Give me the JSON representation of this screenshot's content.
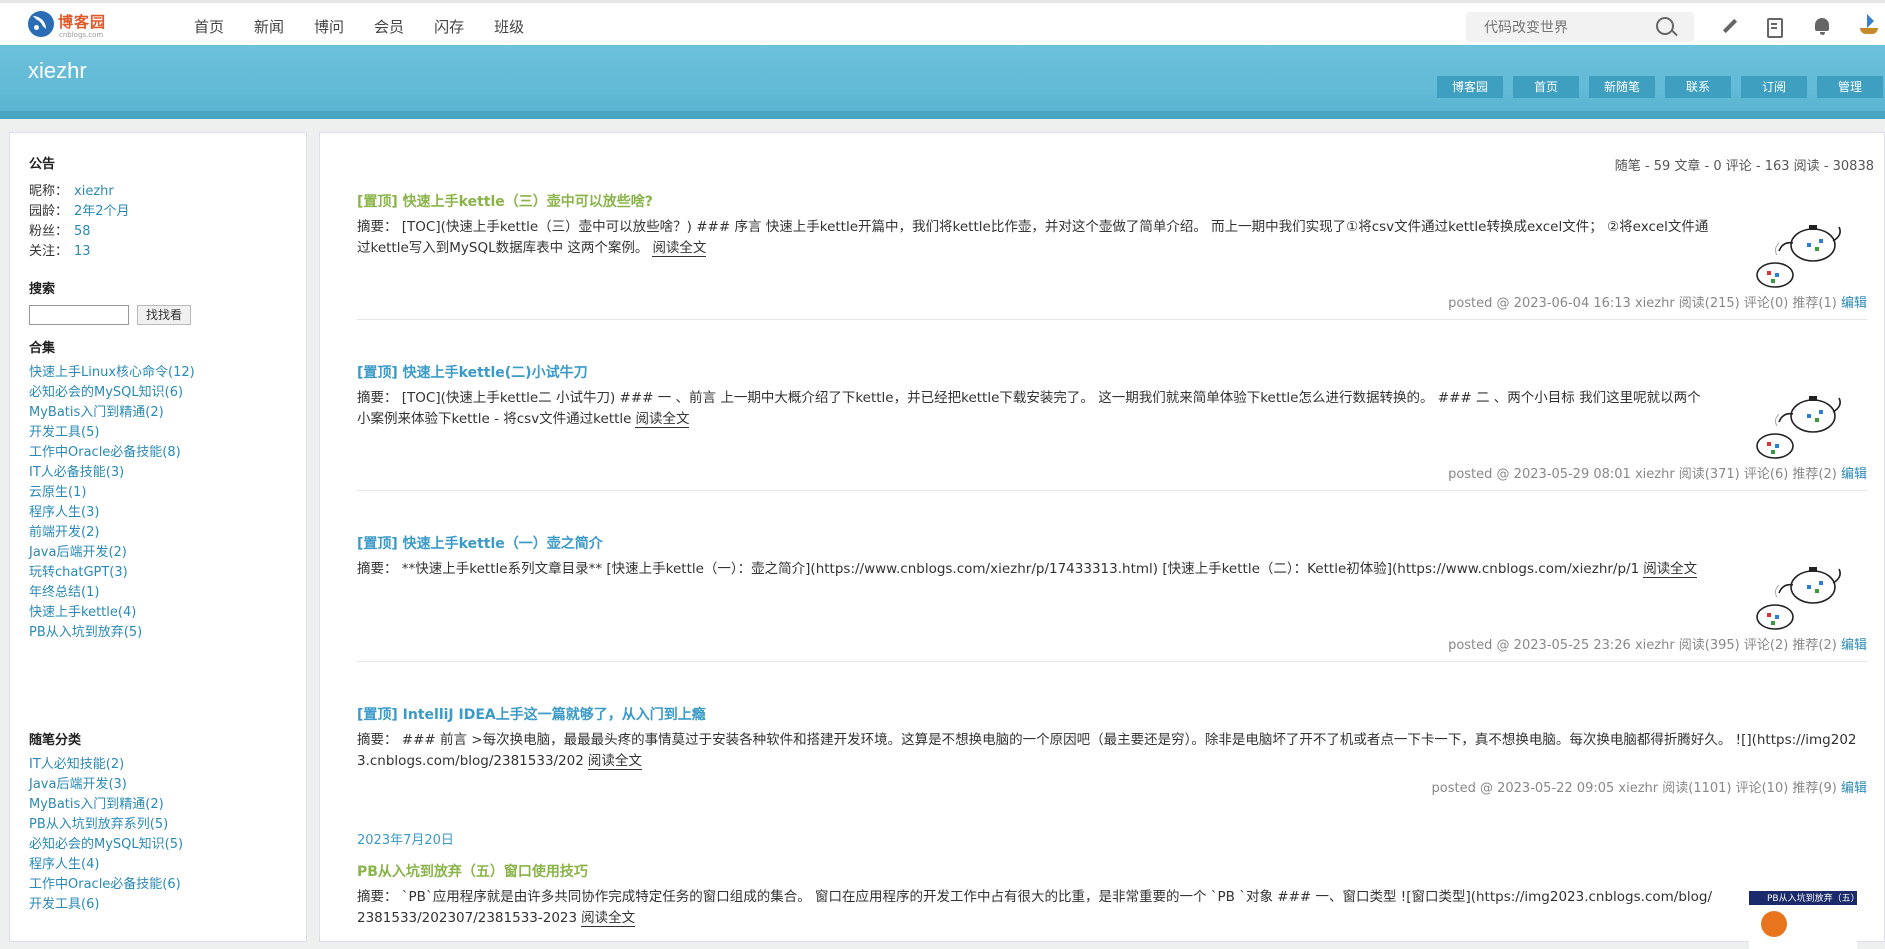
{
  "topbar": {
    "brand": "博客园",
    "brand_sub": "cnblogs.com",
    "nav": [
      "首页",
      "新闻",
      "博问",
      "会员",
      "闪存",
      "班级"
    ],
    "search_placeholder": "代码改变世界"
  },
  "header": {
    "blog_title": "xiezhr",
    "nav": [
      "博客园",
      "首页",
      "新随笔",
      "联系",
      "订阅",
      "管理"
    ]
  },
  "sidebar": {
    "notice_title": "公告",
    "profile": [
      {
        "label": "昵称：",
        "value": "xiezhr"
      },
      {
        "label": "园龄：",
        "value": "2年2个月"
      },
      {
        "label": "粉丝：",
        "value": "58"
      },
      {
        "label": "关注：",
        "value": "13"
      }
    ],
    "search_title": "搜索",
    "search_button": "找找看",
    "collections_title": "合集",
    "collections": [
      "快速上手Linux核心命令(12)",
      "必知必会的MySQL知识(6)",
      "MyBatis入门到精通(2)",
      "开发工具(5)",
      "工作中Oracle必备技能(8)",
      "IT人必备技能(3)",
      "云原生(1)",
      "程序人生(3)",
      "前端开发(2)",
      "Java后端开发(2)",
      "玩转chatGPT(3)",
      "年终总结(1)",
      "快速上手kettle(4)",
      "PB从入坑到放弃(5)"
    ],
    "categories_title": "随笔分类",
    "categories": [
      "IT人必知技能(2)",
      "Java后端开发(3)",
      "MyBatis入门到精通(2)",
      "PB从入坑到放弃系列(5)",
      "必知必会的MySQL知识(5)",
      "程序人生(4)",
      "工作中Oracle必备技能(6)",
      "开发工具(6)"
    ]
  },
  "main": {
    "stats": "随笔 - 59  文章 - 0  评论 - 163  阅读 - 30838",
    "read_more": "阅读全文",
    "edit_label": "编辑",
    "date_header": "2023年7月20日",
    "posts": [
      {
        "title": "[置顶] 快速上手kettle（三）壶中可以放些啥?",
        "summary": "摘要： [TOC](快速上手kettle（三）壶中可以放些啥？) ### 序言 快速上手kettle开篇中，我们将kettle比作壶，并对这个壶做了简单介绍。 而上一期中我们实现了①将csv文件通过kettle转换成excel文件； ②将excel文件通过kettle写入到MySQL数据库表中 这两个案例。",
        "footer": "posted @ 2023-06-04 16:13 xiezhr 阅读(215) 评论(0) 推荐(1)"
      },
      {
        "title": "[置顶] 快速上手kettle(二)小试牛刀",
        "summary": "摘要： [TOC](快速上手kettle二 小试牛刀) ### 一 、前言 上一期中大概介绍了下kettle，并已经把kettle下载安装完了。 这一期我们就来简单体验下kettle怎么进行数据转换的。 ### 二 、两个小目标 我们这里呢就以两个小案例来体验下kettle - 将csv文件通过kettle",
        "footer": "posted @ 2023-05-29 08:01 xiezhr 阅读(371) 评论(6) 推荐(2)"
      },
      {
        "title": "[置顶] 快速上手kettle（一）壶之简介",
        "summary": "摘要： **快速上手kettle系列文章目录** [快速上手kettle（一）：壶之简介](https://www.cnblogs.com/xiezhr/p/17433313.html) [快速上手kettle（二）：Kettle初体验](https://www.cnblogs.com/xiezhr/p/1",
        "footer": "posted @ 2023-05-25 23:26 xiezhr 阅读(395) 评论(2) 推荐(2)"
      },
      {
        "title": "[置顶] IntelliJ IDEA上手这一篇就够了，从入门到上瘾",
        "summary": "摘要： ### 前言 >每次换电脑，最最最头疼的事情莫过于安装各种软件和搭建开发环境。这算是不想换电脑的一个原因吧（最主要还是穷）。除非是电脑坏了开不了机或者点一下卡一下，真不想换电脑。每次换电脑都得折腾好久。 ![](https://img2023.cnblogs.com/blog/2381533/202",
        "footer": "posted @ 2023-05-22 09:05 xiezhr 阅读(1101) 评论(10) 推荐(9)"
      },
      {
        "title": "PB从入坑到放弃（五）窗口使用技巧",
        "summary": "摘要： `PB`应用程序就是由许多共同协作完成特定任务的窗口组成的集合。 窗口在应用程序的开发工作中占有很大的比重，是非常重要的一个 `PB `对象 ### 一、窗口类型 ![窗口类型](https://img2023.cnblogs.com/blog/2381533/202307/2381533-2023"
      }
    ],
    "thumb_caption": "PB从入坑到放弃（五）"
  }
}
